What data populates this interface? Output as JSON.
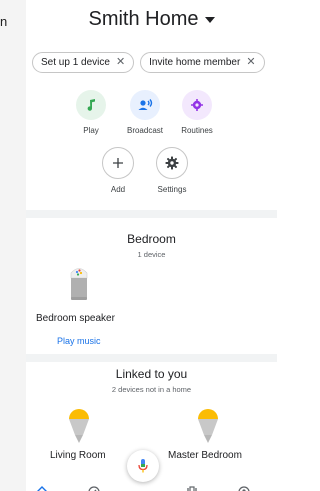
{
  "edge_text": "n",
  "home": {
    "title": "Smith Home"
  },
  "chips": [
    {
      "label": "Set up 1 device"
    },
    {
      "label": "Invite home member"
    }
  ],
  "actions": [
    {
      "label": "Play",
      "icon": "music-note-icon",
      "color": "#34a853",
      "bg": "#e6f4ea"
    },
    {
      "label": "Broadcast",
      "icon": "broadcast-icon",
      "color": "#1a73e8",
      "bg": "#e8f0fe"
    },
    {
      "label": "Routines",
      "icon": "routines-icon",
      "color": "#9334e6",
      "bg": "#f3e8fd"
    },
    {
      "label": "Add",
      "icon": "plus-icon"
    },
    {
      "label": "Settings",
      "icon": "gear-icon"
    }
  ],
  "room": {
    "title": "Bedroom",
    "subtitle": "1 device",
    "device_name": "Bedroom speaker",
    "action_link": "Play music"
  },
  "linked": {
    "title": "Linked to you",
    "subtitle": "2 devices not in a home",
    "devices": [
      {
        "name": "Living Room"
      },
      {
        "name": "Master Bedroom"
      }
    ]
  },
  "colors": {
    "accent": "#1a73e8",
    "lamp_light": "#fbbc04"
  }
}
